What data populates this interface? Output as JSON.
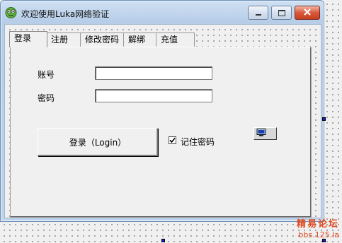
{
  "window": {
    "title": "欢迎使用Luka网络验证",
    "app_icon": "frog-face-icon",
    "controls": {
      "minimize": "minimize-icon",
      "maximize": "maximize-icon",
      "close": "close-icon"
    }
  },
  "tabs": [
    {
      "label": "登录",
      "active": true
    },
    {
      "label": "注册",
      "active": false
    },
    {
      "label": "修改密码",
      "active": false
    },
    {
      "label": "解绑",
      "active": false
    },
    {
      "label": "充值",
      "active": false
    }
  ],
  "login_form": {
    "account_label": "账号",
    "account_value": "",
    "password_label": "密码",
    "password_value": "",
    "login_button": "登录（Login）",
    "remember_label": "记住密码",
    "remember_checked": true
  },
  "watermark": {
    "line1": "精易论坛",
    "line2": "bbs.125.la"
  },
  "colors": {
    "title_bar": "#bfd3ea",
    "close_button": "#c6401f",
    "selection_handle": "#1a1ad0",
    "watermark": "#e24a1f"
  }
}
